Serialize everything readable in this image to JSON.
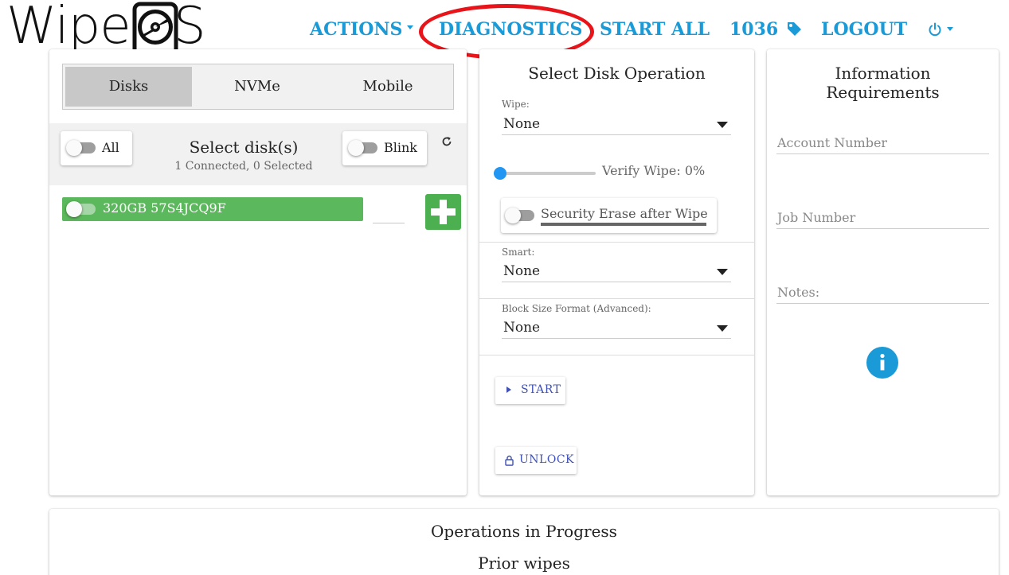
{
  "logo": {
    "text_left": "Wipe",
    "text_right": "S"
  },
  "nav": {
    "actions": "ACTIONS",
    "diagnostics": "DIAGNOSTICS",
    "start_all": "START ALL",
    "license_count": "1036",
    "logout": "LOGOUT"
  },
  "disks_panel": {
    "tabs": [
      "Disks",
      "NVMe",
      "Mobile"
    ],
    "active_tab": "Disks",
    "all_label": "All",
    "select_title": "Select disk(s)",
    "select_status": "1 Connected, 0 Selected",
    "blink_label": "Blink",
    "disks": [
      {
        "label": "320GB 57S4JCQ9F",
        "selected": false
      }
    ]
  },
  "operation_panel": {
    "title": "Select Disk Operation",
    "wipe_label": "Wipe:",
    "wipe_value": "None",
    "verify_label": "Verify Wipe: 0%",
    "verify_percent": 0,
    "security_erase_label": "Security Erase after Wipe",
    "smart_label": "Smart:",
    "smart_value": "None",
    "block_size_label": "Block Size Format (Advanced):",
    "block_size_value": "None",
    "start_label": "START",
    "unlock_label": "UNLOCK"
  },
  "info_panel": {
    "title_line1": "Information",
    "title_line2": "Requirements",
    "account_number_placeholder": "Account Number",
    "job_number_placeholder": "Job Number",
    "notes_placeholder": "Notes:"
  },
  "progress_panel": {
    "operations_title": "Operations in Progress",
    "prior_title": "Prior wipes"
  },
  "colors": {
    "nav_blue": "#1a9ad7",
    "disk_green": "#5cb85c",
    "add_green": "#4caf50",
    "slider_blue": "#2196f3",
    "button_text": "#3f51b5",
    "highlight_red": "#e8141a"
  }
}
